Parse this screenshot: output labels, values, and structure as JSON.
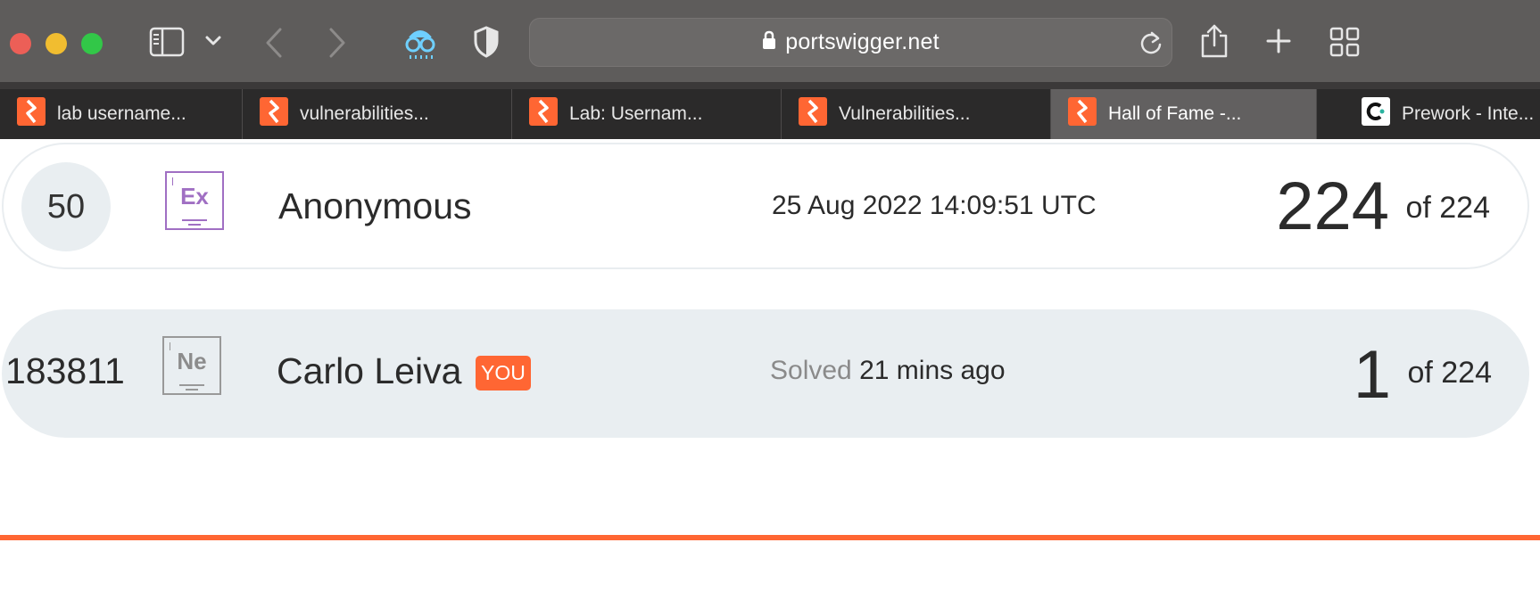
{
  "browser": {
    "address": "portswigger.net",
    "tabs": [
      {
        "label": "lab username...",
        "favicon": "portswigger-icon",
        "active": false
      },
      {
        "label": "vulnerabilities...",
        "favicon": "portswigger-icon",
        "active": false
      },
      {
        "label": "Lab: Usernam...",
        "favicon": "portswigger-icon",
        "active": false
      },
      {
        "label": "Vulnerabilities...",
        "favicon": "portswigger-icon",
        "active": false
      },
      {
        "label": "Hall of Fame -...",
        "favicon": "portswigger-icon",
        "active": true
      },
      {
        "label": "Prework - Inte...",
        "favicon": "c-logo-icon",
        "active": false
      }
    ],
    "toolbar_icons": [
      "sidebar-icon",
      "chevron-down-icon",
      "back-icon",
      "forward-icon",
      "privacy-glasses-icon",
      "shield-icon",
      "lock-icon",
      "reload-icon",
      "share-icon",
      "new-tab-icon",
      "tab-overview-icon"
    ]
  },
  "leaderboard": {
    "rows": [
      {
        "rank": "50",
        "element": "Ex",
        "name": "Anonymous",
        "time": "25 Aug 2022 14:09:51 UTC",
        "score": "224",
        "of": "of 224"
      },
      {
        "rank": "183811",
        "element": "Ne",
        "name": "Carlo Leiva",
        "you_badge": "YOU",
        "solved_label": "Solved",
        "solved_ago": "21 mins ago",
        "score": "1",
        "of": "of 224"
      }
    ]
  },
  "colors": {
    "accent": "#ff6633",
    "toolbar": "#5e5c5b",
    "tabstrip": "#2b2a2a",
    "row_highlight": "#e9eef1",
    "expert_purple": "#a06fc3"
  }
}
